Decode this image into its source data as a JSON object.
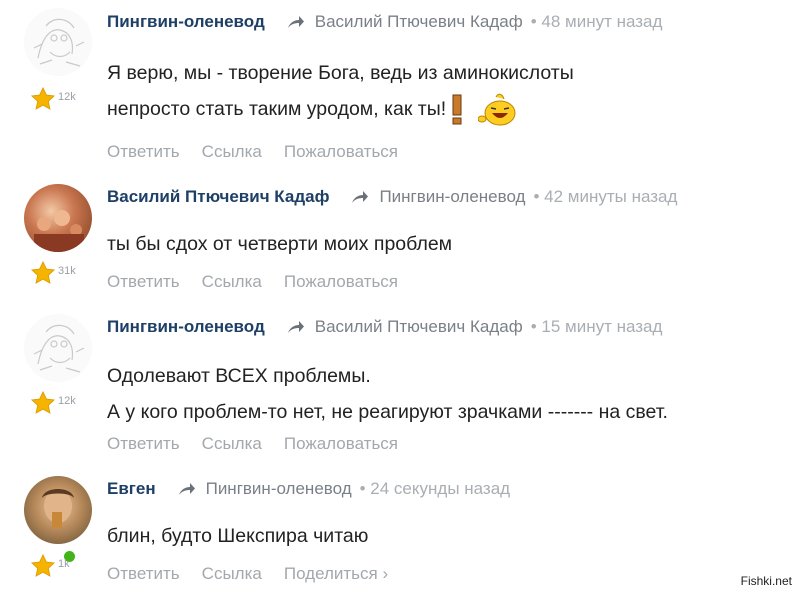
{
  "comments": [
    {
      "author": "Пингвин-оленевод",
      "reply_to": "Василий Птючевич Кадаф",
      "time": "• 48 минут назад",
      "lines": [
        "Я верю, мы - творение Бога, ведь из аминокислоты",
        "непросто стать таким уродом, как ты!"
      ],
      "rating": "12k",
      "actions": [
        "Ответить",
        "Ссылка",
        "Пожаловаться"
      ]
    },
    {
      "author": "Василий Птючевич Кадаф",
      "reply_to": "Пингвин-оленевод",
      "time": "• 42 минуты назад",
      "lines": [
        "ты бы сдох от четверти моих проблем"
      ],
      "rating": "31k",
      "actions": [
        "Ответить",
        "Ссылка",
        "Пожаловаться"
      ]
    },
    {
      "author": "Пингвин-оленевод",
      "reply_to": "Василий Птючевич Кадаф",
      "time": "• 15 минут назад",
      "lines": [
        "Одолевают ВСЕХ проблемы.",
        "А у кого проблем-то нет, не реагируют зрачками ------- на свет."
      ],
      "rating": "12k",
      "actions": [
        "Ответить",
        "Ссылка",
        "Пожаловаться"
      ]
    },
    {
      "author": "Евген",
      "reply_to": "Пингвин-оленевод",
      "time": "• 24 секунды назад",
      "lines": [
        "блин, будто Шекспира читаю"
      ],
      "rating": "1k",
      "actions": [
        "Ответить",
        "Ссылка",
        "Поделиться ›"
      ]
    }
  ],
  "watermark": "Fishki.net",
  "colors": {
    "author": "#1e3f66",
    "meta": "#a3a8ad",
    "star": "#f4b400",
    "online": "#43b31a"
  },
  "icons": [
    "star-icon",
    "reply-arrow-icon",
    "online-indicator",
    "emoji-icon"
  ]
}
